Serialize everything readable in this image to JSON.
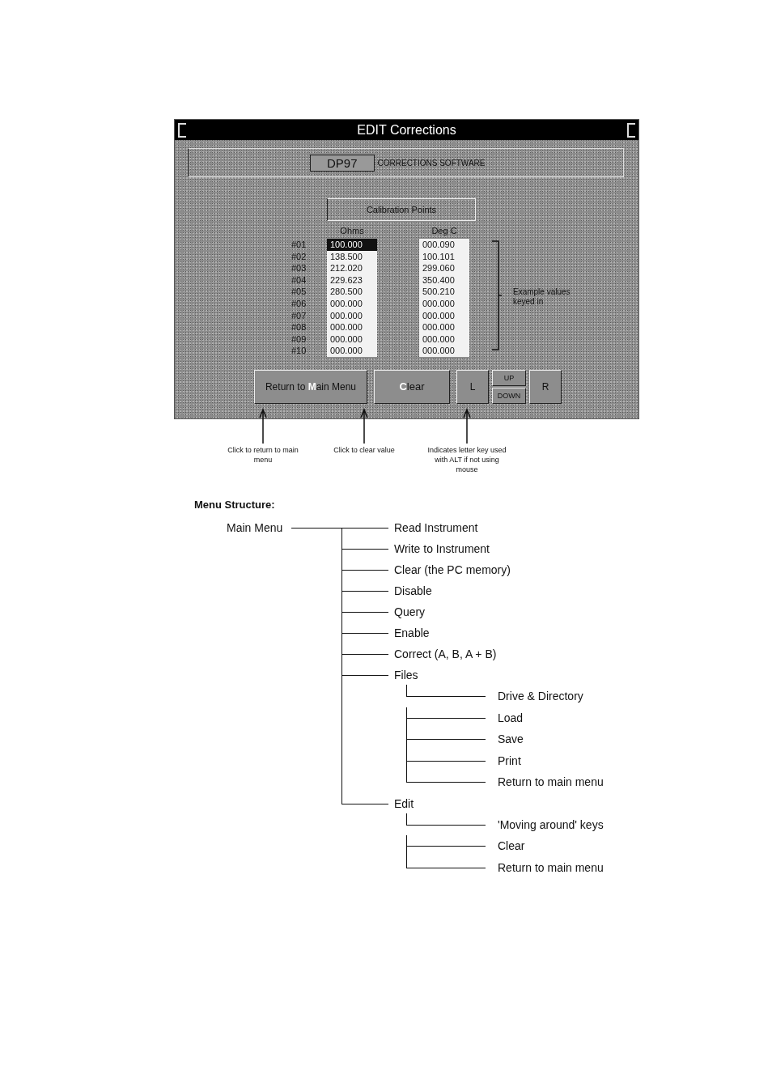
{
  "window": {
    "title": "EDIT Corrections"
  },
  "header": {
    "product": "DP97",
    "subtitle": "CORRECTIONS SOFTWARE"
  },
  "section_title": "Calibration Points",
  "columns": [
    "Ohms",
    "Deg C"
  ],
  "rows": [
    {
      "label": "#01",
      "ohms": "100.000",
      "deg_c": "000.090",
      "selected": true
    },
    {
      "label": "#02",
      "ohms": "138.500",
      "deg_c": "100.101",
      "selected": false
    },
    {
      "label": "#03",
      "ohms": "212.020",
      "deg_c": "299.060",
      "selected": false
    },
    {
      "label": "#04",
      "ohms": "229.623",
      "deg_c": "350.400",
      "selected": false
    },
    {
      "label": "#05",
      "ohms": "280.500",
      "deg_c": "500.210",
      "selected": false
    },
    {
      "label": "#06",
      "ohms": "000.000",
      "deg_c": "000.000",
      "selected": false
    },
    {
      "label": "#07",
      "ohms": "000.000",
      "deg_c": "000.000",
      "selected": false
    },
    {
      "label": "#08",
      "ohms": "000.000",
      "deg_c": "000.000",
      "selected": false
    },
    {
      "label": "#09",
      "ohms": "000.000",
      "deg_c": "000.000",
      "selected": false
    },
    {
      "label": "#10",
      "ohms": "000.000",
      "deg_c": "000.000",
      "selected": false
    }
  ],
  "bracket_note": "Example values keyed in",
  "buttons": [
    {
      "before": "Return to ",
      "key": "M",
      "after": "ain Menu"
    },
    {
      "key": "C",
      "after": "lear"
    }
  ],
  "nav": {
    "left": "L",
    "up": "UP",
    "down": "DOWN",
    "right": "R"
  },
  "callouts": [
    "Click to return to main menu",
    "Click to clear value",
    "Indicates letter key used with ALT if not using mouse"
  ],
  "menu_heading": "Menu Structure:",
  "menu": {
    "label": "Main Menu",
    "children": [
      {
        "label": "Read Instrument"
      },
      {
        "label": "Write to Instrument"
      },
      {
        "label": "Clear (the PC memory)"
      },
      {
        "label": "Disable"
      },
      {
        "label": "Query"
      },
      {
        "label": "Enable"
      },
      {
        "label": "Correct (A, B, A + B)"
      },
      {
        "label": "Files",
        "children": [
          {
            "label": "Drive & Directory"
          },
          {
            "label": "Load"
          },
          {
            "label": "Save"
          },
          {
            "label": "Print"
          },
          {
            "label": "Return to main menu"
          }
        ]
      },
      {
        "label": "Edit",
        "children": [
          {
            "label": "'Moving around' keys"
          },
          {
            "label": "Clear"
          },
          {
            "label": "Return to main menu"
          }
        ]
      }
    ]
  }
}
